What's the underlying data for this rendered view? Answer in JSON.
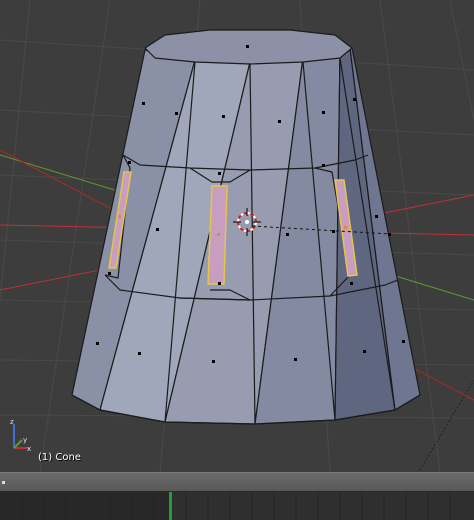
{
  "viewport": {
    "object_label": "(1) Cone"
  },
  "colors": {
    "background": "#3d3d3d",
    "grid": "#484848",
    "mesh_face": "#8a90a6",
    "mesh_edge": "#1b1b1b",
    "selected_face": "#c79ec0",
    "selected_outline": "#e8c34a",
    "x_axis": "#c0303a",
    "y_axis": "#5f9a2f",
    "timeline_frame": "#21a03a"
  },
  "icons": {
    "cursor": "3d-cursor-icon",
    "axes": "view-axis-gizmo-icon"
  }
}
